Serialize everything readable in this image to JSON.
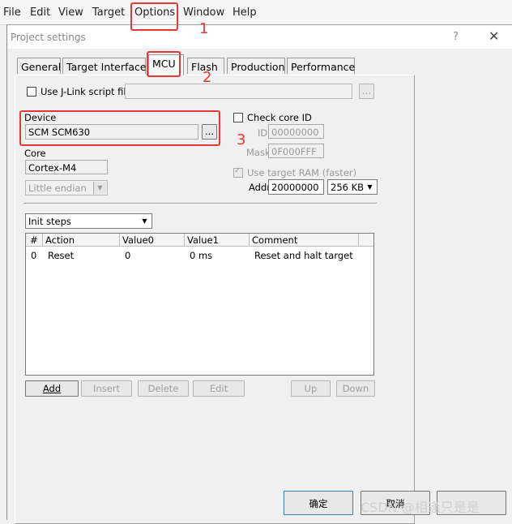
{
  "menu": {
    "items": [
      "File",
      "Edit",
      "View",
      "Target",
      "Options",
      "Window",
      "Help"
    ]
  },
  "dialog": {
    "title": "Project settings",
    "help_glyph": "?",
    "close_glyph": "✕"
  },
  "tabs": [
    {
      "label": "General"
    },
    {
      "label": "Target Interface"
    },
    {
      "label": "MCU"
    },
    {
      "label": "Flash"
    },
    {
      "label": "Production"
    },
    {
      "label": "Performance"
    }
  ],
  "script_file": {
    "label": "Use J-Link script file",
    "value": "",
    "browse_label": "..."
  },
  "device": {
    "label": "Device",
    "value": "SCM SCM630",
    "browse_label": "..."
  },
  "core": {
    "label": "Core",
    "value": "Cortex-M4"
  },
  "endian": {
    "value": "Little endian"
  },
  "check_core": {
    "label": "Check core ID",
    "id_label": "ID",
    "id_value": "00000000",
    "mask_label": "Mask",
    "mask_value": "0F000FFF"
  },
  "target_ram": {
    "label": "Use target RAM (faster)",
    "addr_label": "Addr",
    "addr_value": "20000000",
    "size_value": "256 KB"
  },
  "init_steps": {
    "selected": "Init steps",
    "columns": [
      "#",
      "Action",
      "Value0",
      "Value1",
      "Comment"
    ],
    "rows": [
      {
        "num": "0",
        "action": "Reset",
        "value0": "0",
        "value1": "0 ms",
        "comment": "Reset and halt target"
      }
    ]
  },
  "step_buttons": {
    "add": "Add",
    "insert": "Insert",
    "delete": "Delete",
    "edit": "Edit",
    "up": "Up",
    "down": "Down"
  },
  "footer": {
    "ok": "确定",
    "cancel": "取消"
  },
  "annotations": [
    "1",
    "2",
    "3"
  ],
  "watermark": "CSDN @相逢只是是",
  "colors": {
    "annotation_red": "#e53935",
    "window_bg": "#f0f0f0"
  }
}
